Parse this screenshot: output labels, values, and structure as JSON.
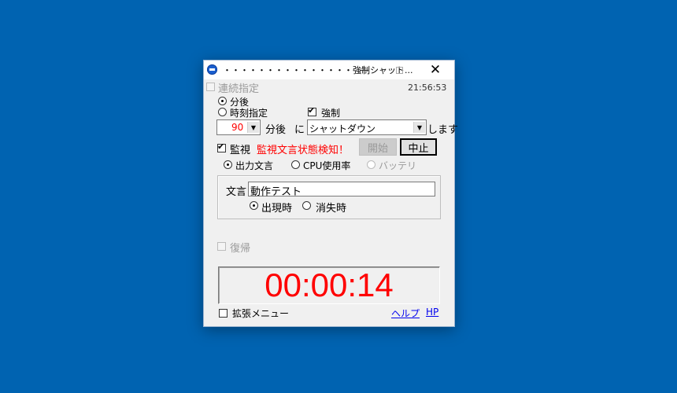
{
  "window": {
    "title": "・・・・・・・・・・・・・・・強制シャット...",
    "close_glyph": "✕",
    "time": "21:56:53"
  },
  "renzoku": {
    "label": "連続指定",
    "checked": false,
    "disabled": true
  },
  "mode": {
    "after_label": "分後",
    "clock_label": "時刻指定",
    "selected": "after"
  },
  "force": {
    "label": "強制",
    "checked": true
  },
  "schedule": {
    "minutes": "90",
    "minutes_unit": "分後",
    "particle": "に",
    "action": "シャットダウン",
    "suffix": "します",
    "minutes_color": "#FF0000"
  },
  "monitor": {
    "label": "監視",
    "checked": true,
    "status": "監視文言状態検知！",
    "status_color": "#FF0000",
    "start_label": "開始",
    "stop_label": "中止"
  },
  "source": {
    "text_label": "出力文言",
    "cpu_label": "CPU使用率",
    "battery_label": "バッテリ",
    "selected": "text"
  },
  "phrase": {
    "label": "文言",
    "value": "動作テスト",
    "appear_label": "出現時",
    "disappear_label": "消失時",
    "selected": "appear"
  },
  "restore": {
    "label": "復帰",
    "checked": false,
    "disabled": true
  },
  "countdown": {
    "value": "00:00:14",
    "color": "#FF0000"
  },
  "footer": {
    "expand_label": "拡張メニュー",
    "help_link": "ヘルプ",
    "hp_link": "HP"
  }
}
